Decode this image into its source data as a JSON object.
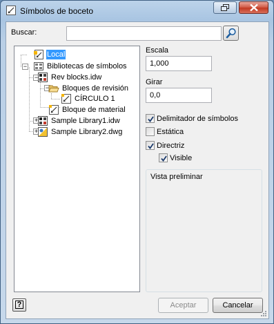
{
  "window": {
    "title": "Símbolos de boceto"
  },
  "search": {
    "label": "Buscar:",
    "value": ""
  },
  "tree": {
    "local": "Local",
    "libraries": "Bibliotecas de símbolos",
    "rev_blocks": "Rev blocks.idw",
    "revision_blocks": "Bloques de revisión",
    "circle": "CÍRCULO 1",
    "material_block": "Bloque de material",
    "sample1": "Sample Library1.idw",
    "sample2": "Sample Library2.dwg"
  },
  "scale": {
    "label": "Escala",
    "value": "1,000"
  },
  "rotate": {
    "label": "Girar",
    "value": "0,0"
  },
  "options": {
    "symbol_clipping": {
      "label": "Delimitador de símbolos",
      "checked": true
    },
    "static": {
      "label": "Estática",
      "checked": false
    },
    "leader": {
      "label": "Directriz",
      "checked": true
    },
    "visible": {
      "label": "Visible",
      "checked": true
    }
  },
  "preview": {
    "label": "Vista preliminar"
  },
  "buttons": {
    "help": "?",
    "ok": "Aceptar",
    "ok_enabled": false,
    "cancel": "Cancelar"
  },
  "icons": {
    "title": "sketch-symbol-icon",
    "search": "magnifier-icon",
    "local": "local-symbol-icon",
    "library": "library-icon",
    "idw": "idw-document-icon",
    "folder": "folder-open-icon",
    "symbol": "sketch-symbol-icon",
    "dwg": "dwg-document-icon"
  }
}
